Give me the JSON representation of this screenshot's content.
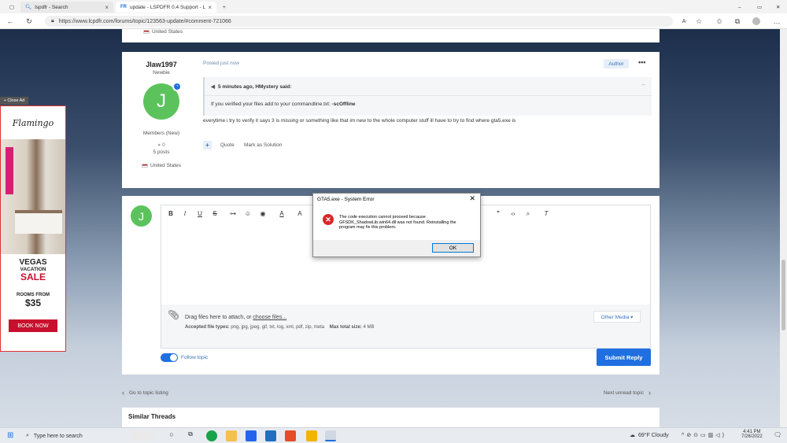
{
  "browser": {
    "tabs": [
      {
        "label": "lspdfr - Search"
      },
      {
        "label": "update - LSPDFR 0.4 Support - L"
      }
    ],
    "url": "https://www.lcpdfr.com/forums/topic/123563-update/#comment-721066"
  },
  "prev_post": {
    "location": "United States"
  },
  "post": {
    "author": "Jlaw1997",
    "rank": "Newbie",
    "avatar_letter": "J",
    "group": "Members (New)",
    "reputation": "0",
    "posts": "5 posts",
    "location": "United States",
    "posted": "Posted just now",
    "author_badge": "Author",
    "quote_header": "5 minutes ago, HMystery said:",
    "quote_text": "If you verified your files add to your commandline.txt: ",
    "quote_bold": "-scOffline",
    "body": "everytime i try to verify it says 3 is missing or something like that im new to the whole computer stuff ill have to try to find where gta5.exe is",
    "actions": {
      "plus": "+",
      "quote": "Quote",
      "mark": "Mark as Solution"
    }
  },
  "editor": {
    "avatar_letter": "J",
    "drop_text": "Drag files here to attach, or ",
    "choose_files": "choose files...",
    "accepted_label": "Accepted file types:",
    "accepted_types": "png, jpg, jpeg, gif, txt, log, xml, pdf, zip, meta",
    "max_label": "Max total size:",
    "max_size": "4 MB",
    "other_media": "Other Media ▾",
    "follow": "Follow topic",
    "submit": "Submit Reply"
  },
  "nav": {
    "prev": "Go to topic listing",
    "next": "Next unread topic"
  },
  "similar": "Similar Threads",
  "ad": {
    "close": "+ Close Ad",
    "vegas": "VEGAS",
    "vacation": "VACATION",
    "sale": "SALE",
    "rooms": "ROOMS FROM",
    "price": "$35",
    "book": "BOOK NOW",
    "brand": "Flamingo"
  },
  "dialog": {
    "title": "GTA5.exe - System Error",
    "message": "The code execution cannot proceed because GFSDK_ShadowLib.win64.dll was not found. Reinstalling the program may fix this problem.",
    "ok": "OK"
  },
  "taskbar": {
    "search": "Type here to search",
    "weather": "69°F  Cloudy",
    "time": "4:41 PM",
    "date": "7/26/2022"
  }
}
